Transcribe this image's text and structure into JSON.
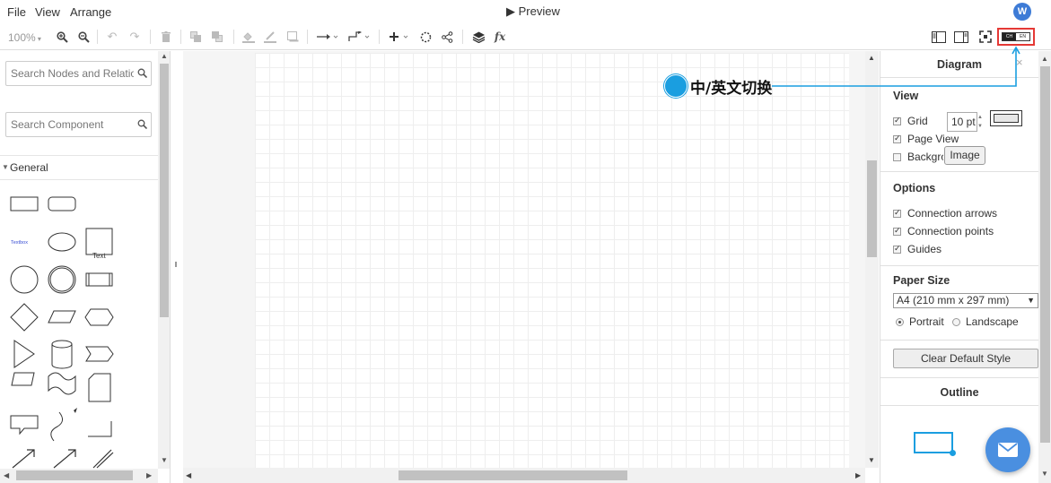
{
  "menu": {
    "file": "File",
    "view": "View",
    "arrange": "Arrange"
  },
  "preview_label": "▶ Preview",
  "user_initial": "W",
  "toolbar": {
    "zoom": "100%"
  },
  "left_panel": {
    "search_nodes_placeholder": "Search Nodes and Relations",
    "search_component_placeholder": "Search Component",
    "general_label": "General",
    "text_shape_label": "Text",
    "textbox_shape_label": "Textbox"
  },
  "annotation": {
    "label": "中/英文切换",
    "color": "#1a9ee0"
  },
  "lang_toggle": {
    "left": "CH",
    "right": "EN"
  },
  "right_panel": {
    "title": "Diagram",
    "close": "×",
    "view": {
      "heading": "View",
      "grid_label": "Grid",
      "grid_size": "10 pt",
      "page_view_label": "Page View",
      "background_label": "Background",
      "image_button": "Image"
    },
    "options": {
      "heading": "Options",
      "items": [
        "Connection arrows",
        "Connection points",
        "Guides"
      ]
    },
    "paper_size": {
      "heading": "Paper Size",
      "selected": "A4 (210 mm x 297 mm)",
      "portrait": "Portrait",
      "landscape": "Landscape"
    },
    "clear_default_style": "Clear Default Style",
    "outline_heading": "Outline"
  },
  "colors": {
    "accent": "#1a9ee0",
    "highlight": "#e53935",
    "fab": "#4a8fe0",
    "avatar": "#3d7bd6"
  }
}
